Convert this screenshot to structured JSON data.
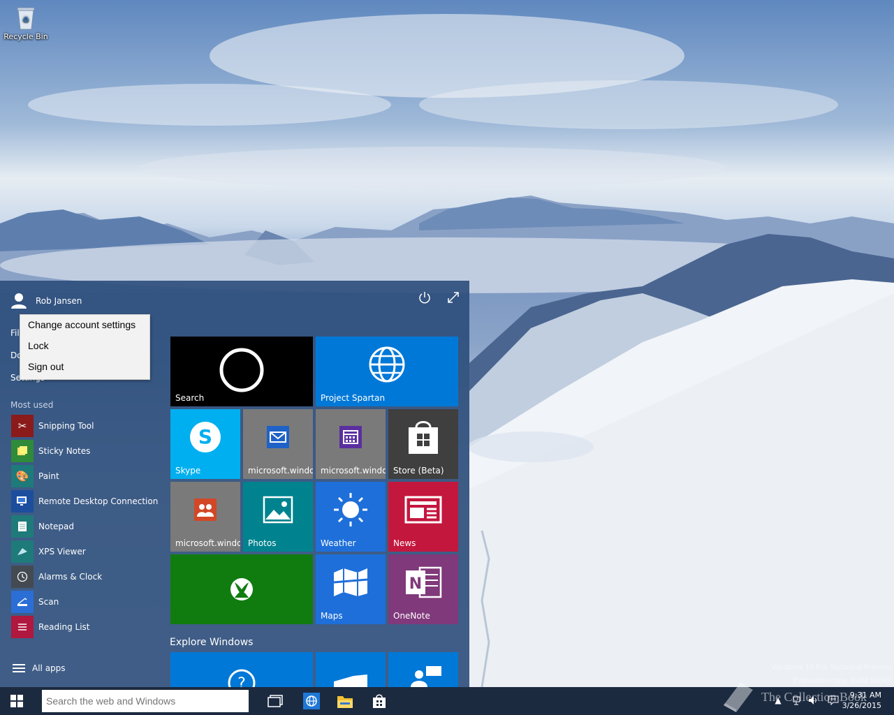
{
  "desktop": {
    "recycle_bin_label": "Recycle Bin"
  },
  "watermark": {
    "line1": "Windows 10 Pro Technical Preview",
    "line2": "Evaluation copy. Build 10049"
  },
  "start_menu": {
    "user_name": "Rob Jansen",
    "side_links": [
      "File Explorer",
      "Documents",
      "Settings"
    ],
    "most_used_header": "Most used",
    "most_used": [
      {
        "label": "Snipping Tool",
        "icon": "scissors-icon",
        "color": "#8b1a1a"
      },
      {
        "label": "Sticky Notes",
        "icon": "sticky-notes-icon",
        "color": "#2f8a3a"
      },
      {
        "label": "Paint",
        "icon": "paint-icon",
        "color": "#1f7a7a"
      },
      {
        "label": "Remote Desktop Connection",
        "icon": "remote-desktop-icon",
        "color": "#1d4e9e"
      },
      {
        "label": "Notepad",
        "icon": "notepad-icon",
        "color": "#1f7a7a"
      },
      {
        "label": "XPS Viewer",
        "icon": "xps-viewer-icon",
        "color": "#1f7a7a"
      },
      {
        "label": "Alarms & Clock",
        "icon": "clock-icon",
        "color": "#444a52"
      },
      {
        "label": "Scan",
        "icon": "scan-icon",
        "color": "#2b6ed6"
      },
      {
        "label": "Reading List",
        "icon": "reading-list-icon",
        "color": "#b0183f"
      }
    ],
    "all_apps_label": "All apps",
    "explore_header": "Explore Windows",
    "tiles": {
      "search": "Search",
      "spartan": "Project Spartan",
      "skype": "Skype",
      "mail": "microsoft.windo",
      "calendar": "microsoft.windo",
      "store": "Store (Beta)",
      "people": "microsoft.windo",
      "photos": "Photos",
      "weather": "Weather",
      "news": "News",
      "maps": "Maps",
      "onenote": "OneNote"
    }
  },
  "account_menu": {
    "items": [
      "Change account settings",
      "Lock",
      "Sign out"
    ]
  },
  "taskbar": {
    "search_placeholder": "Search the web and Windows",
    "time": "9:31 AM",
    "date": "3/26/2015",
    "collection_text": "The Collection Book"
  },
  "colors": {
    "start_bg": "#2b4c7a",
    "tile_blue": "#0078d7",
    "tile_gray": "#7a7a7a",
    "taskbar": "#1c2a40"
  }
}
